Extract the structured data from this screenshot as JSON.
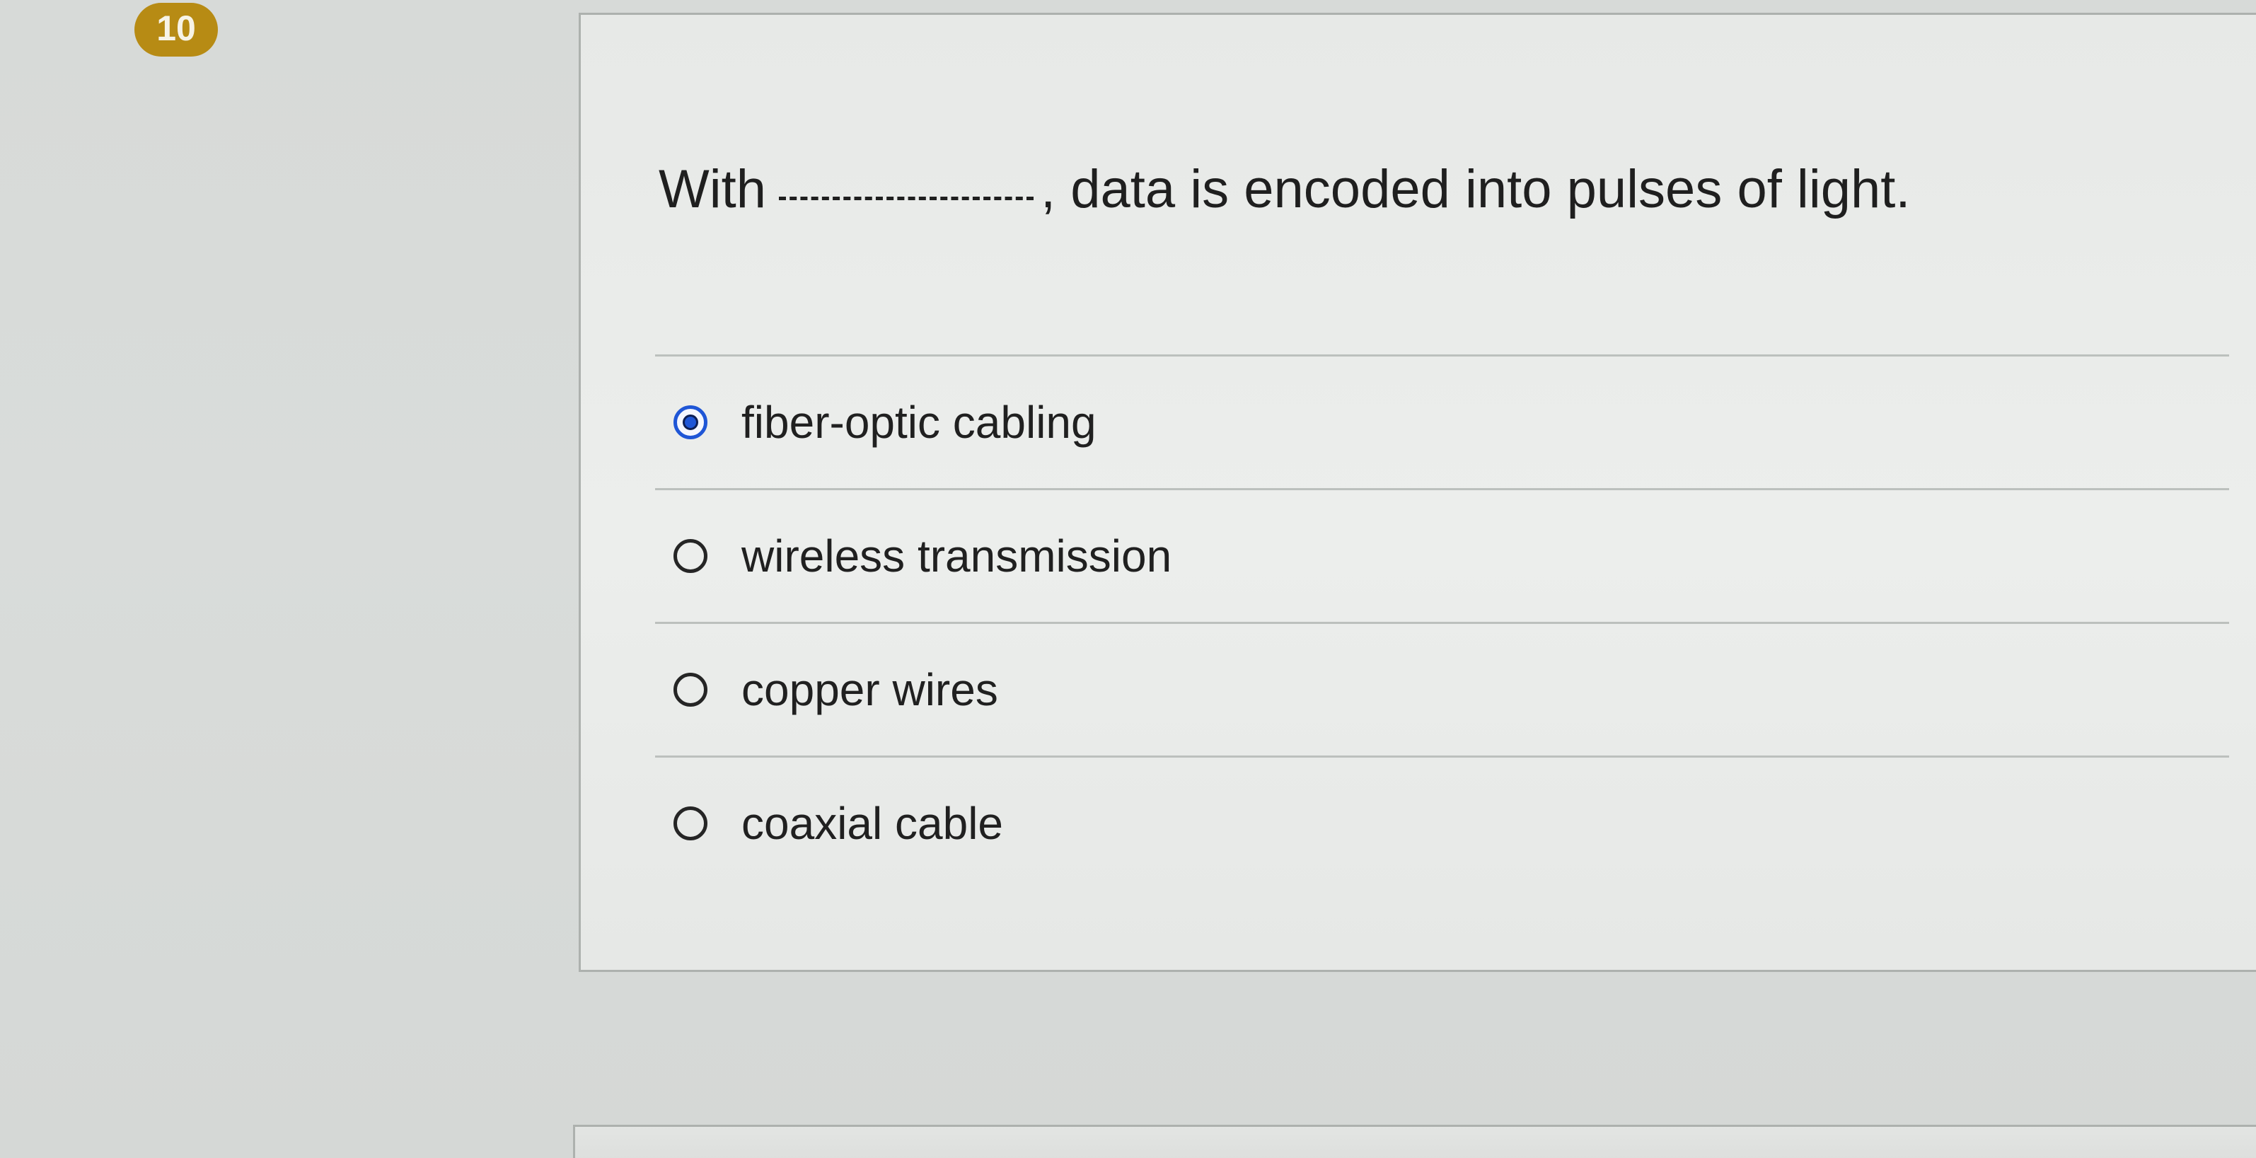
{
  "question": {
    "number": "10",
    "prefix": "With",
    "suffix": ", data is encoded into pulses of light."
  },
  "answers": [
    {
      "label": "fiber-optic cabling",
      "selected": true
    },
    {
      "label": "wireless transmission",
      "selected": false
    },
    {
      "label": "copper wires",
      "selected": false
    },
    {
      "label": "coaxial cable",
      "selected": false
    }
  ],
  "colors": {
    "badge": "#b78b14",
    "selected_radio": "#1f56d6"
  }
}
